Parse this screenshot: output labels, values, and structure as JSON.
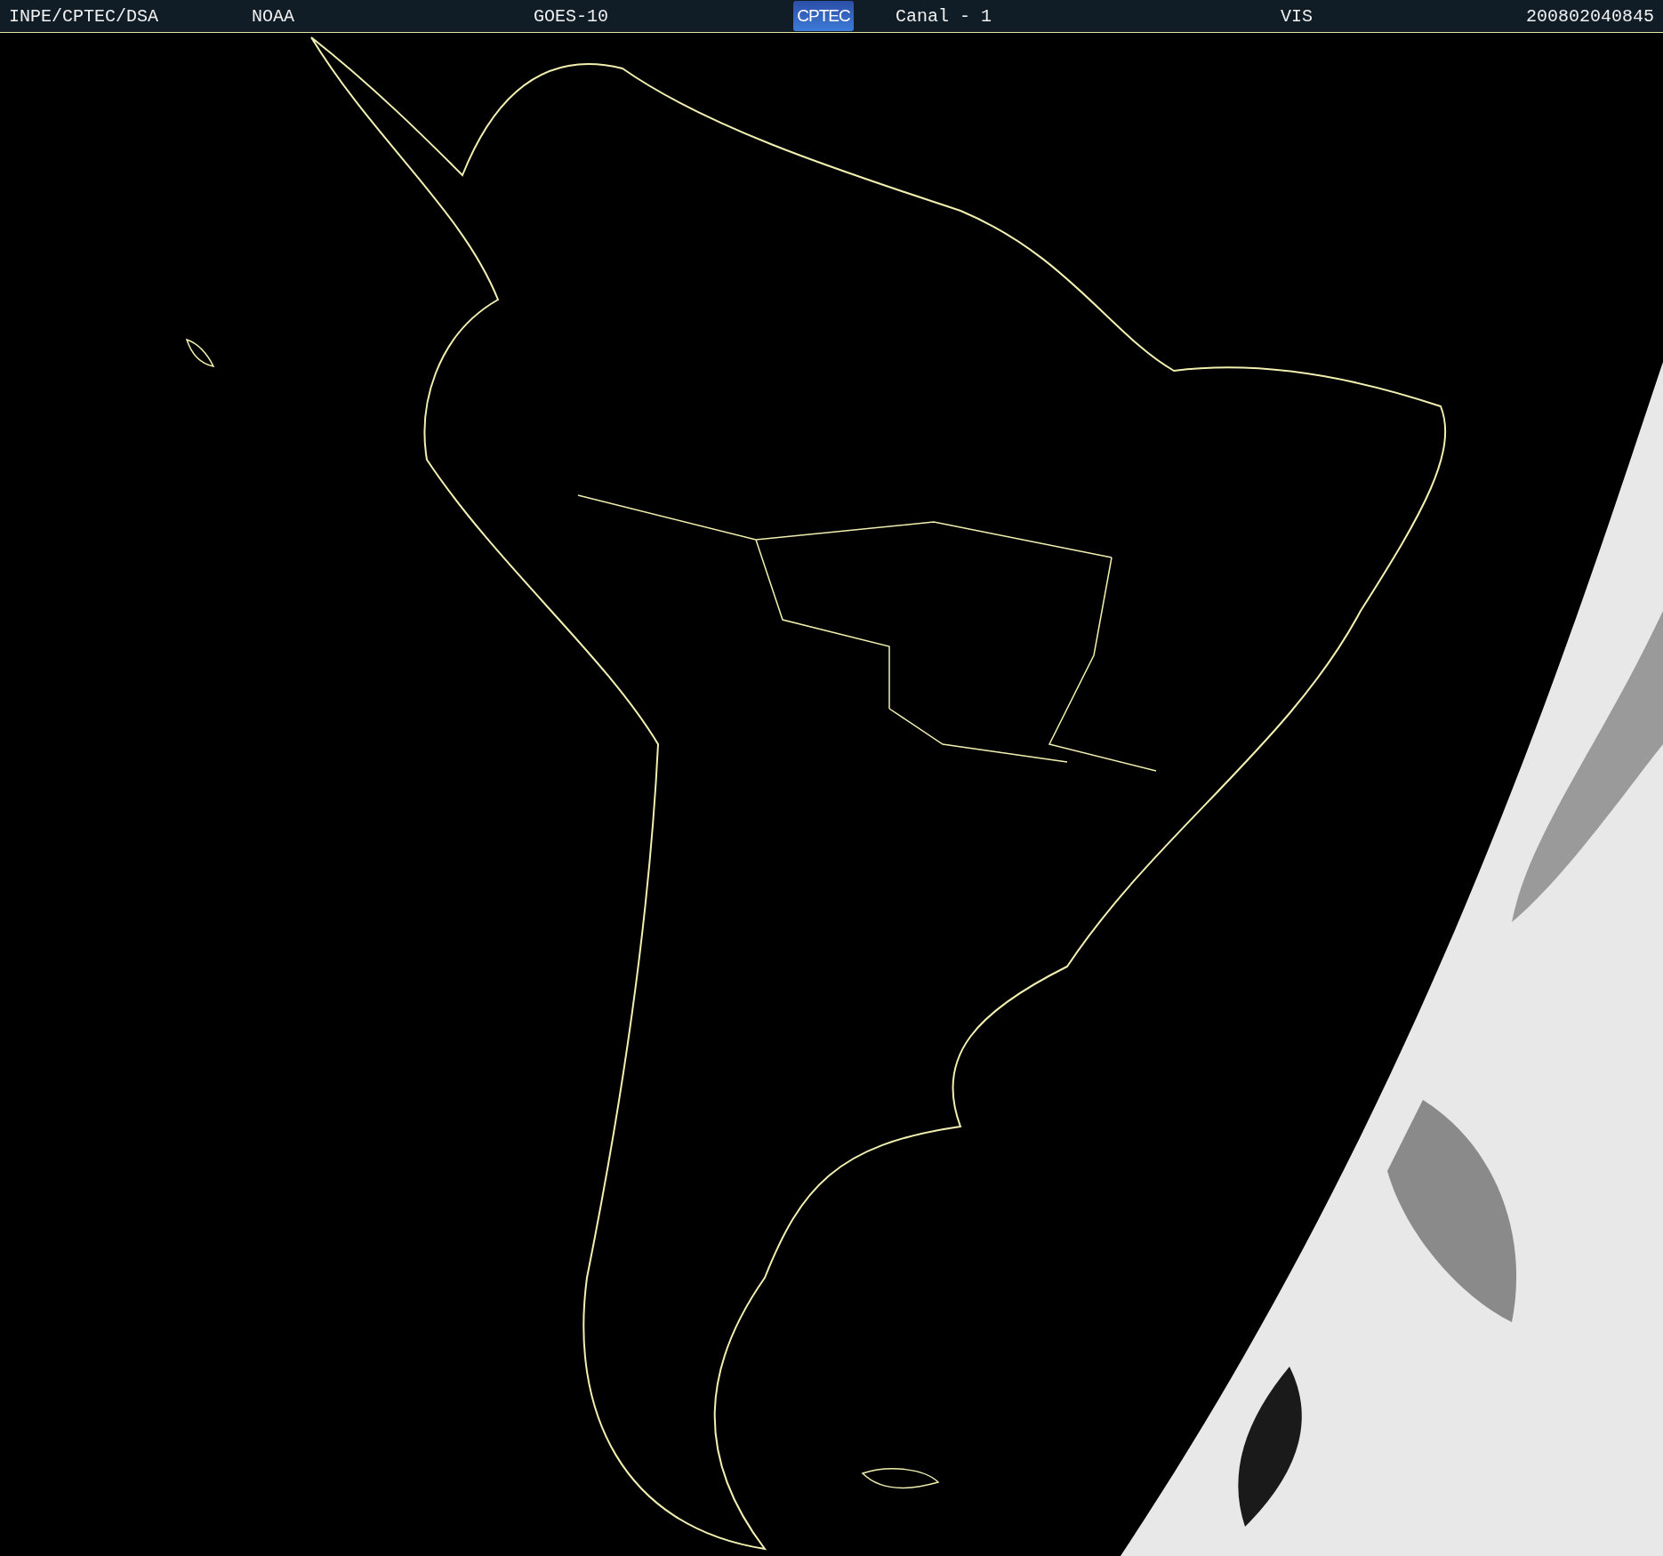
{
  "header": {
    "items": [
      {
        "kind": "text",
        "text": "INPE/CPTEC/DSA"
      },
      {
        "kind": "text",
        "text": "NOAA"
      },
      {
        "kind": "text",
        "text": "GOES-10"
      },
      {
        "kind": "logo",
        "text": "CPTEC"
      },
      {
        "kind": "text",
        "text": "Canal - 1"
      },
      {
        "kind": "text",
        "text": "VIS"
      },
      {
        "kind": "text",
        "text": "200802040845"
      }
    ]
  }
}
